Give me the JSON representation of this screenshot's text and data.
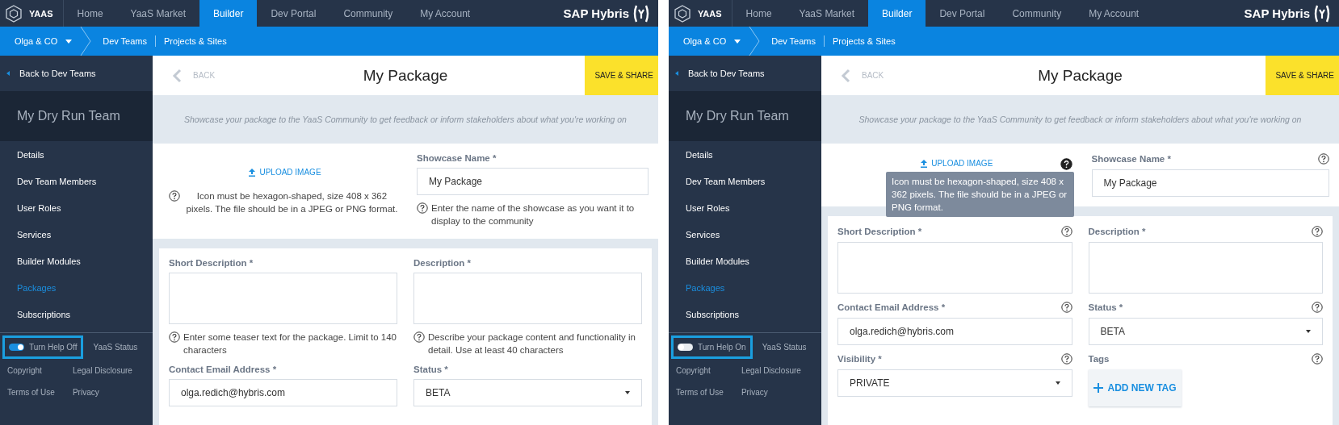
{
  "panels": [
    {
      "kind": "inline_help",
      "nav": {
        "logo": "YAAS",
        "items": [
          {
            "label": "Home",
            "selected": false
          },
          {
            "label": "YaaS Market",
            "selected": false
          },
          {
            "label": "Builder",
            "selected": true
          },
          {
            "label": "Dev Portal",
            "selected": false
          },
          {
            "label": "Community",
            "selected": false
          },
          {
            "label": "My Account",
            "selected": false
          }
        ],
        "brand": "SAP Hybris"
      },
      "breadcrumb": {
        "org": "Olga & CO",
        "items": [
          "Dev Teams",
          "Projects & Sites"
        ]
      },
      "sidebar": {
        "back": "Back to Dev Teams",
        "team": "My Dry Run Team",
        "items": [
          {
            "label": "Details",
            "selected": false
          },
          {
            "label": "Dev Team Members",
            "selected": false
          },
          {
            "label": "User Roles",
            "selected": false
          },
          {
            "label": "Services",
            "selected": false
          },
          {
            "label": "Builder Modules",
            "selected": false
          },
          {
            "label": "Packages",
            "selected": true
          },
          {
            "label": "Subscriptions",
            "selected": false
          }
        ],
        "help_toggle": {
          "label": "Turn Help Off",
          "on": true,
          "highlighted": true
        },
        "status_link": "YaaS Status",
        "footer_links": [
          "Copyright",
          "Legal Disclosure",
          "Terms of Use",
          "Privacy"
        ]
      },
      "page": {
        "back": "BACK",
        "title": "My Package",
        "save": "SAVE & SHARE",
        "intro": "Showcase your package to the YaaS Community to get feedback or inform stakeholders about what you're working on",
        "upload": {
          "label": "UPLOAD IMAGE",
          "help": "Icon must be hexagon-shaped, size 408 x 362 pixels. The file should be in a JPEG or PNG format."
        },
        "showcase": {
          "label": "Showcase Name *",
          "value": "My Package",
          "help": "Enter the name of the showcase as you want it to display to the community"
        },
        "fields": [
          {
            "kind": "textarea",
            "label": "Short Description *",
            "help": "Enter some teaser text for the package. Limit to 140 characters"
          },
          {
            "kind": "textarea",
            "label": "Description *",
            "help": "Describe your package content and functionality in detail. Use at least 40 characters"
          },
          {
            "kind": "text",
            "label": "Contact Email Address *",
            "value": "olga.redich@hybris.com"
          },
          {
            "kind": "select",
            "label": "Status *",
            "value": "BETA"
          }
        ]
      }
    },
    {
      "kind": "icon_help",
      "nav": {
        "logo": "YAAS",
        "items": [
          {
            "label": "Home",
            "selected": false
          },
          {
            "label": "YaaS Market",
            "selected": false
          },
          {
            "label": "Builder",
            "selected": true
          },
          {
            "label": "Dev Portal",
            "selected": false
          },
          {
            "label": "Community",
            "selected": false
          },
          {
            "label": "My Account",
            "selected": false
          }
        ],
        "brand": "SAP Hybris"
      },
      "breadcrumb": {
        "org": "Olga & CO",
        "items": [
          "Dev Teams",
          "Projects & Sites"
        ]
      },
      "sidebar": {
        "back": "Back to Dev Teams",
        "team": "My Dry Run Team",
        "items": [
          {
            "label": "Details",
            "selected": false
          },
          {
            "label": "Dev Team Members",
            "selected": false
          },
          {
            "label": "User Roles",
            "selected": false
          },
          {
            "label": "Services",
            "selected": false
          },
          {
            "label": "Builder Modules",
            "selected": false
          },
          {
            "label": "Packages",
            "selected": true
          },
          {
            "label": "Subscriptions",
            "selected": false
          }
        ],
        "help_toggle": {
          "label": "Turn Help On",
          "on": false,
          "highlighted": true
        },
        "status_link": "YaaS Status",
        "footer_links": [
          "Copyright",
          "Legal Disclosure",
          "Terms of Use",
          "Privacy"
        ]
      },
      "page": {
        "back": "BACK",
        "title": "My Package",
        "save": "SAVE & SHARE",
        "intro": "Showcase your package to the YaaS Community to get feedback or inform stakeholders about what you're working on",
        "upload": {
          "label": "UPLOAD IMAGE",
          "help": "Icon must be hexagon-shaped, size 408 x 362 pixels. The file should be in a JPEG or PNG format.",
          "help_open": true
        },
        "showcase": {
          "label": "Showcase Name *",
          "value": "My Package"
        },
        "fields": [
          {
            "kind": "textarea",
            "label": "Short Description *"
          },
          {
            "kind": "textarea",
            "label": "Description *"
          },
          {
            "kind": "text",
            "label": "Contact Email Address *",
            "value": "olga.redich@hybris.com"
          },
          {
            "kind": "select",
            "label": "Status *",
            "value": "BETA"
          },
          {
            "kind": "select",
            "label": "Visibility *",
            "value": "PRIVATE"
          },
          {
            "kind": "tags",
            "label": "Tags",
            "value": "ADD NEW TAG"
          }
        ]
      }
    }
  ]
}
